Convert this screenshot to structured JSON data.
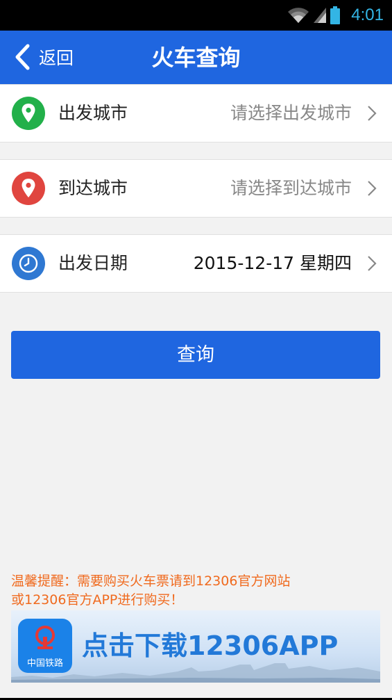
{
  "status_bar": {
    "time": "4:01",
    "icons": [
      "wifi-icon",
      "signal-icon",
      "battery-icon"
    ],
    "clock_color": "#33b5e5"
  },
  "header": {
    "back_label": "返回",
    "title": "火车查询",
    "color": "#1f66e0"
  },
  "rows": [
    {
      "label": "出发城市",
      "value": "请选择出发城市",
      "icon": "location-pin-icon",
      "icon_color": "#22b04a"
    },
    {
      "label": "到达城市",
      "value": "请选择到达城市",
      "icon": "location-pin-icon",
      "icon_color": "#e0453f"
    },
    {
      "label": "出发日期",
      "value": "2015-12-17 星期四",
      "icon": "clock-icon",
      "icon_color": "#2f78d2"
    }
  ],
  "search_button": {
    "label": "查询"
  },
  "notice": {
    "line1": "温馨提醒：需要购买火车票请到12306官方网站",
    "line2": "或12306官方APP进行购买！",
    "color": "#f06a1e"
  },
  "banner": {
    "text": "点击下载12306APP",
    "logo_text": "中国铁路"
  }
}
